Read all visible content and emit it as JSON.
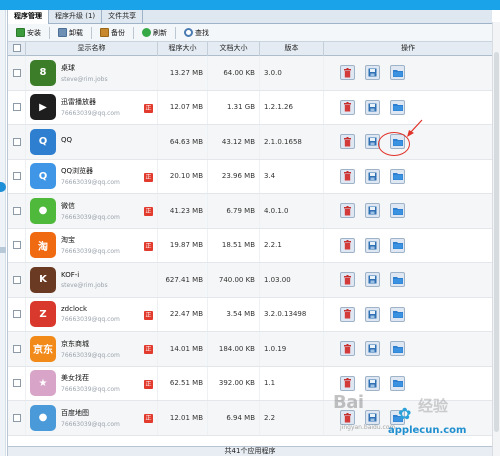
{
  "tabs": [
    {
      "label": "程序管理",
      "active": true
    },
    {
      "label": "程序升级 (1)",
      "active": false
    },
    {
      "label": "文件共享",
      "active": false
    }
  ],
  "toolbar": {
    "install": "安装",
    "uninstall": "卸载",
    "backup": "备份",
    "refresh": "刷新",
    "search": "查找"
  },
  "columns": {
    "name": "显示名称",
    "size": "程序大小",
    "doc": "文档大小",
    "version": "版本",
    "actions": "操作"
  },
  "badge_label": "正",
  "apps": [
    {
      "name": "桌球",
      "dev": "steve@rim.jobs",
      "size": "13.27 MB",
      "doc": "64.00 KB",
      "version": "3.0.0",
      "badge": false,
      "icon": "billiards-icon",
      "color": "#3c7d2a",
      "glyph": "8"
    },
    {
      "name": "迅雷播放器",
      "dev": "76663039@qq.com",
      "size": "12.07 MB",
      "doc": "1.31 GB",
      "version": "1.2.1.26",
      "badge": true,
      "icon": "xunlei-player-icon",
      "color": "#1e1e1e",
      "glyph": "▶"
    },
    {
      "name": "QQ",
      "dev": "",
      "size": "64.63 MB",
      "doc": "43.12 MB",
      "version": "2.1.0.1658",
      "badge": false,
      "icon": "qq-penguin-icon",
      "color": "#2f7fd0",
      "glyph": "Q"
    },
    {
      "name": "QQ浏览器",
      "dev": "76663039@qq.com",
      "size": "20.10 MB",
      "doc": "23.96 MB",
      "version": "3.4",
      "badge": true,
      "icon": "qq-browser-icon",
      "color": "#3f96e6",
      "glyph": "Q"
    },
    {
      "name": "微信",
      "dev": "76663039@qq.com",
      "size": "41.23 MB",
      "doc": "6.79 MB",
      "version": "4.0.1.0",
      "badge": true,
      "icon": "wechat-icon",
      "color": "#4fb93c",
      "glyph": "●"
    },
    {
      "name": "淘宝",
      "dev": "76663039@qq.com",
      "size": "19.87 MB",
      "doc": "18.51 MB",
      "version": "2.2.1",
      "badge": true,
      "icon": "taobao-icon",
      "color": "#f06a12",
      "glyph": "淘"
    },
    {
      "name": "KOF-i",
      "dev": "steve@rim.jobs",
      "size": "627.41 MB",
      "doc": "740.00 KB",
      "version": "1.03.00",
      "badge": false,
      "icon": "kof-game-icon",
      "color": "#6b3a22",
      "glyph": "K"
    },
    {
      "name": "zdclock",
      "dev": "76663039@qq.com",
      "size": "22.47 MB",
      "doc": "3.54 MB",
      "version": "3.2.0.13498",
      "badge": true,
      "icon": "zdclock-icon",
      "color": "#d9392c",
      "glyph": "Z"
    },
    {
      "name": "京东商城",
      "dev": "76663039@qq.com",
      "size": "14.01 MB",
      "doc": "184.00 KB",
      "version": "1.0.19",
      "badge": true,
      "icon": "jd-mall-icon",
      "color": "#f28a1a",
      "glyph": "京东"
    },
    {
      "name": "美女找茬",
      "dev": "76663039@qq.com",
      "size": "62.51 MB",
      "doc": "392.00 KB",
      "version": "1.1",
      "badge": true,
      "icon": "beauty-game-icon",
      "color": "#d8a5c8",
      "glyph": "★"
    },
    {
      "name": "百度地图",
      "dev": "76663039@qq.com",
      "size": "12.01 MB",
      "doc": "6.94 MB",
      "version": "2.2",
      "badge": true,
      "icon": "baidu-map-icon",
      "color": "#4a9ad9",
      "glyph": "●"
    }
  ],
  "footer": "共41个应用程序",
  "watermark": {
    "baidu": "Bai",
    "jingyan": "经验",
    "site": "applecun.com",
    "site_url_small": "jingyan.baidu.com"
  },
  "colors": {
    "accent": "#1aa3e8",
    "badge": "#e23a2d",
    "annotation": "#e0332a"
  }
}
